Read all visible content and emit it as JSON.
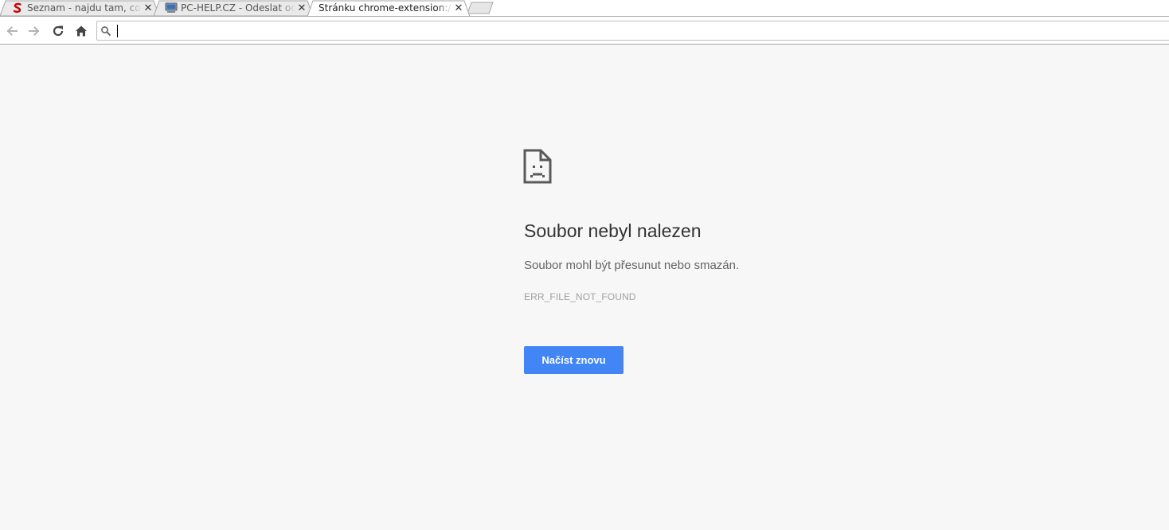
{
  "tabs": [
    {
      "title": "Seznam - najdu tam, co neznám",
      "favicon": "seznam-s-icon",
      "close_glyph": "✕"
    },
    {
      "title": "PC-HELP.CZ - Odeslat odpověď",
      "favicon": "computer-icon",
      "close_glyph": "✕"
    },
    {
      "title": "Stránku chrome-extension://c",
      "favicon": "none",
      "close_glyph": "✕",
      "active": true
    }
  ],
  "toolbar": {
    "back_icon": "arrow-left-icon",
    "forward_icon": "arrow-right-icon",
    "reload_icon": "reload-icon",
    "home_icon": "home-icon",
    "omnibox": {
      "value": "",
      "icon": "search-icon"
    }
  },
  "error_page": {
    "icon": "sad-document-icon",
    "heading": "Soubor nebyl nalezen",
    "description": "Soubor mohl být přesunut nebo smazán.",
    "error_code": "ERR_FILE_NOT_FOUND",
    "reload_label": "Načíst znovu"
  },
  "colors": {
    "page_background": "#f7f7f7",
    "button_blue": "#4285f4",
    "seznam_red": "#cc0000"
  }
}
